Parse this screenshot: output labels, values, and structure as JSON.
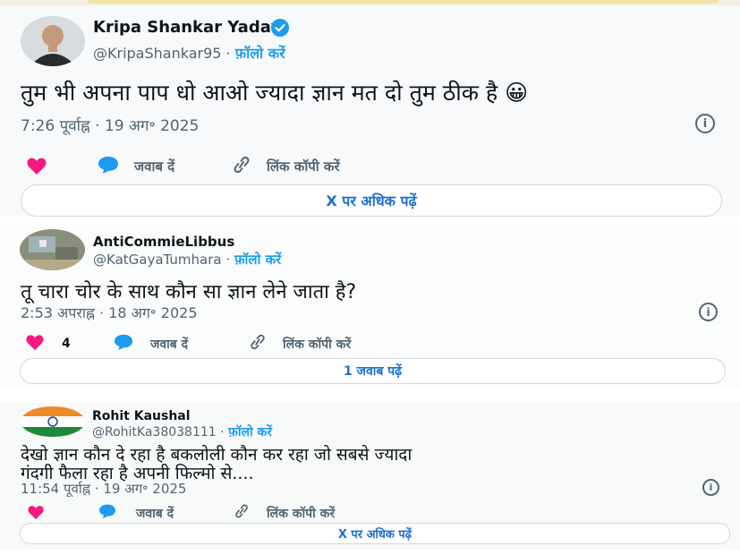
{
  "tweets": [
    {
      "name": "Kripa Shankar Yadav",
      "handle": "@KripaShankar95",
      "separator": "·",
      "follow": "फ़ॉलो करें",
      "text": "तुम भी अपना पाप धो आओ ज्यादा ज्ञान मत दो तुम ठीक है 😀",
      "timestamp": "7:26 पूर्वाह्न · 19 अग॰ 2025",
      "likes": "",
      "reply": "जवाब दें",
      "copy_link": "लिंक कॉपी करें",
      "read_more": "X पर अधिक पढ़ें",
      "verified": true,
      "icons": [
        "heart-icon",
        "reply-bubble-icon",
        "link-icon",
        "info-icon",
        "verified-badge-icon"
      ]
    },
    {
      "name": "AntiCommieLibbus",
      "handle": "@KatGayaTumhara",
      "separator": "·",
      "follow": "फ़ॉलो करें",
      "text": "तू चारा चोर के साथ कौन सा ज्ञान लेने जाता है?",
      "timestamp": "2:53 अपराह्न · 18 अग॰ 2025",
      "likes": "4",
      "reply": "जवाब दें",
      "copy_link": "लिंक कॉपी करें",
      "read_more": "1 जवाब पढ़ें"
    },
    {
      "name": "Rohit Kaushal",
      "handle": "@RohitKa38038111",
      "separator": "·",
      "follow": "फ़ॉलो करें",
      "text_line1": "देखो ज्ञान कौन दे रहा है बकलोली कौन कर रहा जो सबसे ज्यादा",
      "text_line2": "गंदगी फैला रहा है अपनी फिल्मो से....",
      "timestamp": "11:54 पूर्वाह्न · 19 अग॰ 2025",
      "likes": "",
      "reply": "जवाब दें",
      "copy_link": "लिंक कॉपी करें",
      "read_more": "X पर अधिक पढ़ें"
    }
  ],
  "colors": {
    "heart": "#f91880",
    "bubble": "#1d9bf0",
    "link_text": "#1d6fd1",
    "muted": "#536471"
  }
}
